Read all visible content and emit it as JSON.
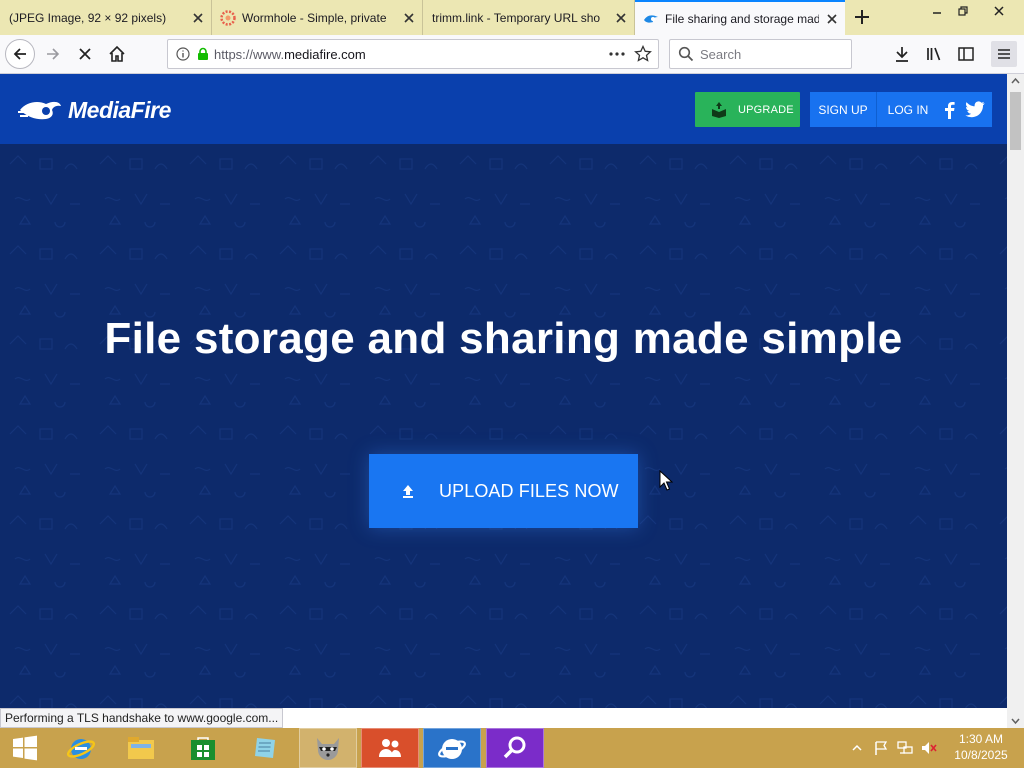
{
  "browser": {
    "tabs": [
      {
        "title": "(JPEG Image, 92 × 92 pixels)",
        "active": false
      },
      {
        "title": "Wormhole - Simple, private",
        "active": false
      },
      {
        "title": "trimm.link - Temporary URL sho",
        "active": false
      },
      {
        "title": "File sharing and storage mad",
        "active": true
      }
    ],
    "url_prefix": "https://www.",
    "url_domain": "mediafire.com",
    "search_placeholder": "Search",
    "status_text": "Performing a TLS handshake to www.google.com...",
    "accent_color": "#0a84ff"
  },
  "site": {
    "logo_text": "MediaFire",
    "upgrade_label": "UPGRADE",
    "signup_label": "SIGN UP",
    "login_label": "LOG IN",
    "hero_title": "File storage and sharing made simple",
    "upload_label": "UPLOAD FILES NOW",
    "colors": {
      "header": "#0a40ad",
      "background": "#0d2a6b",
      "upgrade": "#29b35a",
      "button": "#1976f2"
    }
  },
  "taskbar": {
    "clock_time": "1:30 AM",
    "clock_date": "10/8/2025",
    "apps": [
      "start-windows-icon",
      "internet-explorer-icon",
      "file-explorer-icon",
      "store-icon",
      "notepad-icon",
      "raccoon-app-icon",
      "people-app-icon",
      "internet-explorer-icon",
      "search-app-icon"
    ]
  }
}
